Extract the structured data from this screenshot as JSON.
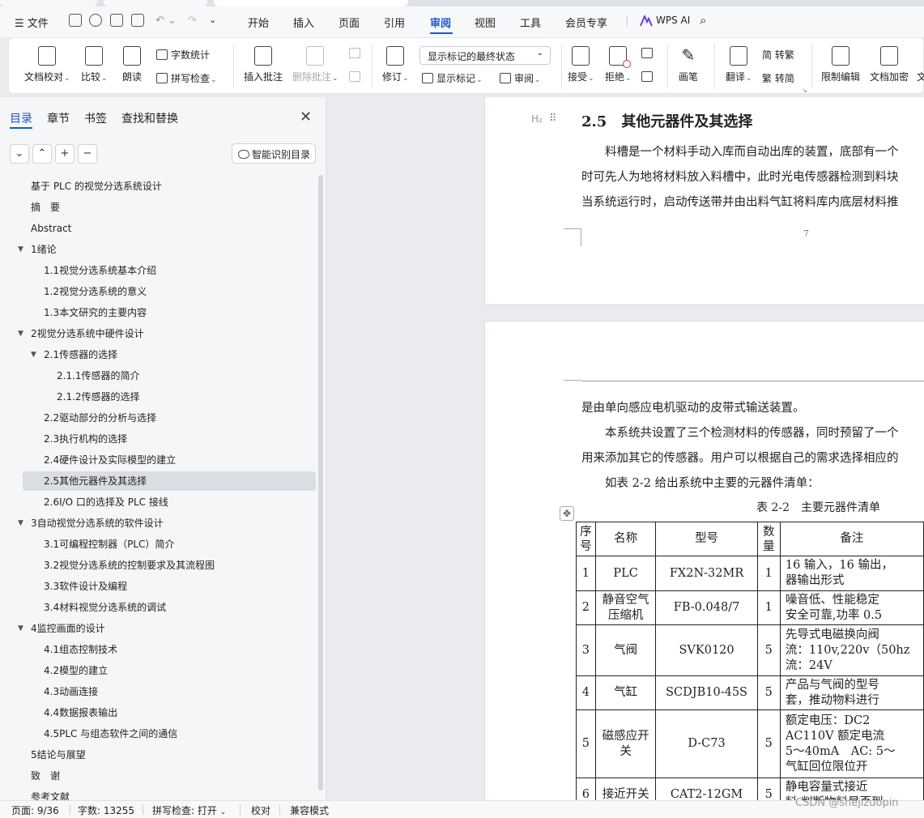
{
  "menubar": {
    "file": "文件",
    "tabs": [
      "开始",
      "插入",
      "页面",
      "引用",
      "审阅",
      "视图",
      "工具",
      "会员专享"
    ],
    "active_tab": "审阅",
    "wps_ai": "WPS AI"
  },
  "ribbon": {
    "doc_check": "文档校对",
    "compare": "比较",
    "read_aloud": "朗读",
    "word_count": "字数统计",
    "spell_check": "拼写检查",
    "insert_comment": "插入批注",
    "delete_comment": "删除批注",
    "revise": "修订",
    "markup_state": "显示标记的最终状态",
    "show_markup": "显示标记",
    "review": "审阅",
    "accept": "接受",
    "reject": "拒绝",
    "pen": "画笔",
    "translate": "翻译",
    "to_traditional": "简 转繁",
    "to_simplified": "繁 转简",
    "restrict_edit": "限制编辑",
    "encrypt": "文档加密",
    "more": "文"
  },
  "panel": {
    "tabs": [
      "目录",
      "章节",
      "书签",
      "查找和替换"
    ],
    "smart_toc": "智能识别目录",
    "toc": [
      {
        "label": "基于 PLC 的视觉分选系统设计",
        "level": 0,
        "arrow": ""
      },
      {
        "label": "摘　要",
        "level": 0,
        "arrow": ""
      },
      {
        "label": "Abstract",
        "level": 0,
        "arrow": ""
      },
      {
        "label": "1绪论",
        "level": 0,
        "arrow": "▼"
      },
      {
        "label": "1.1视觉分选系统基本介绍",
        "level": 1,
        "arrow": ""
      },
      {
        "label": "1.2视觉分选系统的意义",
        "level": 1,
        "arrow": ""
      },
      {
        "label": "1.3本文研究的主要内容",
        "level": 1,
        "arrow": ""
      },
      {
        "label": "2视觉分选系统中硬件设计",
        "level": 0,
        "arrow": "▼"
      },
      {
        "label": "2.1传感器的选择",
        "level": 1,
        "arrow": "▼"
      },
      {
        "label": "2.1.1传感器的简介",
        "level": 2,
        "arrow": ""
      },
      {
        "label": "2.1.2传感器的选择",
        "level": 2,
        "arrow": ""
      },
      {
        "label": "2.2驱动部分的分析与选择",
        "level": 1,
        "arrow": ""
      },
      {
        "label": "2.3执行机构的选择",
        "level": 1,
        "arrow": ""
      },
      {
        "label": "2.4硬件设计及实际模型的建立",
        "level": 1,
        "arrow": ""
      },
      {
        "label": "2.5其他元器件及其选择",
        "level": 1,
        "arrow": "",
        "selected": true
      },
      {
        "label": "2.6I/O 口的选择及 PLC 接线",
        "level": 1,
        "arrow": ""
      },
      {
        "label": "3自动视觉分选系统的软件设计",
        "level": 0,
        "arrow": "▼"
      },
      {
        "label": "3.1可编程控制器（PLC）简介",
        "level": 1,
        "arrow": ""
      },
      {
        "label": "3.2视觉分选系统的控制要求及其流程图",
        "level": 1,
        "arrow": ""
      },
      {
        "label": "3.3软件设计及编程",
        "level": 1,
        "arrow": ""
      },
      {
        "label": "3.4材料视觉分选系统的调试",
        "level": 1,
        "arrow": ""
      },
      {
        "label": "4监控画面的设计",
        "level": 0,
        "arrow": "▼"
      },
      {
        "label": "4.1组态控制技术",
        "level": 1,
        "arrow": ""
      },
      {
        "label": "4.2模型的建立",
        "level": 1,
        "arrow": ""
      },
      {
        "label": "4.3动画连接",
        "level": 1,
        "arrow": ""
      },
      {
        "label": "4.4数据报表输出",
        "level": 1,
        "arrow": ""
      },
      {
        "label": "4.5PLC 与组态软件之间的通信",
        "level": 1,
        "arrow": ""
      },
      {
        "label": "5结论与展望",
        "level": 0,
        "arrow": ""
      },
      {
        "label": "致　谢",
        "level": 0,
        "arrow": ""
      },
      {
        "label": "参考文献",
        "level": 0,
        "arrow": ""
      }
    ]
  },
  "doc": {
    "h2_mark": "H₂",
    "heading": "2.5　其他元器件及其选择",
    "p1_lines": [
      "　　料槽是一个材料手动入库而自动出库的装置，底部有一个",
      "时可先人为地将材料放入料槽中，此时光电传感器检测到料块",
      "当系统运行时，启动传送带并由出料气缸将料库内底层材料推"
    ],
    "page_number": "7",
    "p2_line1": "是由单向感应电机驱动的皮带式输送装置。",
    "p2_lines": [
      "　　本系统共设置了三个检测材料的传感器，同时预留了一个",
      "用来添加其它的传感器。用户可以根据自己的需求选择相应的",
      "　　如表 2-2 给出系统中主要的元器件清单："
    ],
    "table_caption": "表 2-2　主要元器件清单",
    "table_header": [
      "序号",
      "名称",
      "型号",
      "数量",
      "备注"
    ],
    "table_rows": [
      {
        "no": "1",
        "name": "PLC",
        "model": "FX2N-32MR",
        "qty": "1",
        "note": "16 输入，16 输出，\n器输出形式"
      },
      {
        "no": "2",
        "name": "静音空气\n压缩机",
        "model": "FB-0.048/7",
        "qty": "1",
        "note": "噪音低、性能稳定\n安全可靠,功率 0.5"
      },
      {
        "no": "3",
        "name": "气阀",
        "model": "SVK0120",
        "qty": "5",
        "note": "先导式电磁换向阀\n流：110v,220v（50hz\n流：24V"
      },
      {
        "no": "4",
        "name": "气缸",
        "model": "SCDJB10-45S",
        "qty": "5",
        "note": "产品与气阀的型号\n套，推动物料进行"
      },
      {
        "no": "5",
        "name": "磁感应开\n关",
        "model": "D-C73",
        "qty": "5",
        "note": "额定电压：DC2\nAC110V 额定电流\n5～40mA　AC: 5～\n气缸回位限位开"
      },
      {
        "no": "6",
        "name": "接近开关",
        "model": "CAT2-12GM",
        "qty": "5",
        "note": "静电容量式接近\n料 判断物料是否到"
      }
    ]
  },
  "status": {
    "page": "页面: 9/36",
    "words": "字数: 13255",
    "spell": "拼写检查: 打开",
    "proof": "校对",
    "compat": "兼容模式"
  },
  "watermark": "CSDN @shejizuopin",
  "colors": {
    "accent": "#1a56db",
    "selected_row": "#dadde3"
  }
}
